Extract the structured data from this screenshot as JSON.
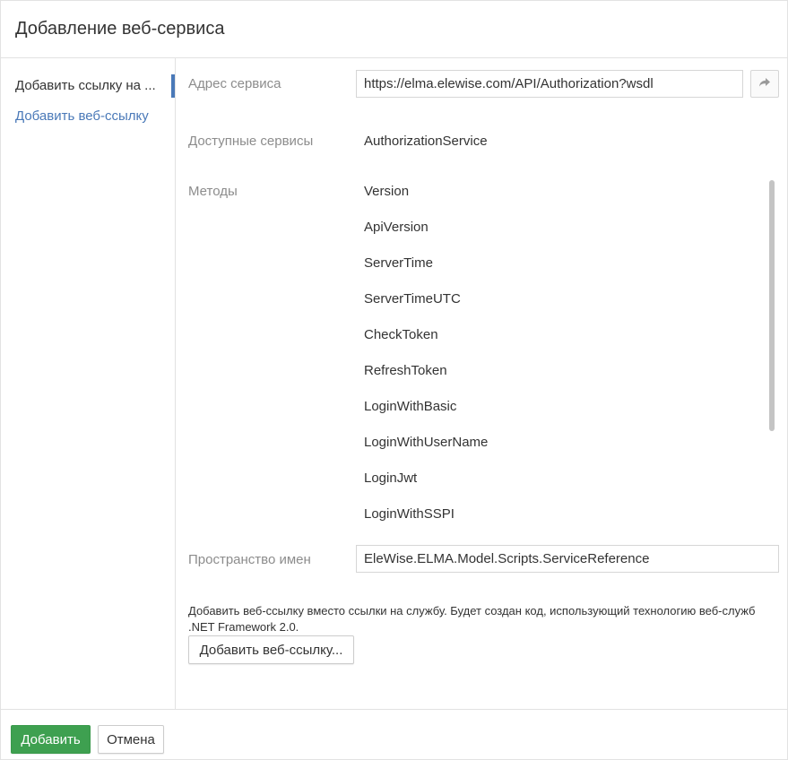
{
  "dialog": {
    "title": "Добавление веб-сервиса"
  },
  "sidebar": {
    "items": [
      {
        "label": "Добавить ссылку на ..."
      },
      {
        "label": "Добавить веб-ссылку"
      }
    ]
  },
  "form": {
    "service_address": {
      "label": "Адрес сервиса",
      "value": "https://elma.elewise.com/API/Authorization?wsdl"
    },
    "available_services": {
      "label": "Доступные сервисы",
      "value": "AuthorizationService"
    },
    "methods": {
      "label": "Методы",
      "items": [
        "Version",
        "ApiVersion",
        "ServerTime",
        "ServerTimeUTC",
        "CheckToken",
        "RefreshToken",
        "LoginWithBasic",
        "LoginWithUserName",
        "LoginJwt",
        "LoginWithSSPI"
      ]
    },
    "namespace": {
      "label": "Пространство имен",
      "value": "EleWise.ELMA.Model.Scripts.ServiceReference"
    },
    "web_reference_note": "Добавить веб-ссылку вместо ссылки на службу. Будет создан код, использующий технологию веб-служб .NET Framework 2.0.",
    "add_web_reference_label": "Добавить веб-ссылку..."
  },
  "footer": {
    "add_label": "Добавить",
    "cancel_label": "Отмена"
  },
  "icons": {
    "go": "share-arrow-icon"
  },
  "colors": {
    "accent": "#4a79b8",
    "primary": "#3ea050"
  }
}
